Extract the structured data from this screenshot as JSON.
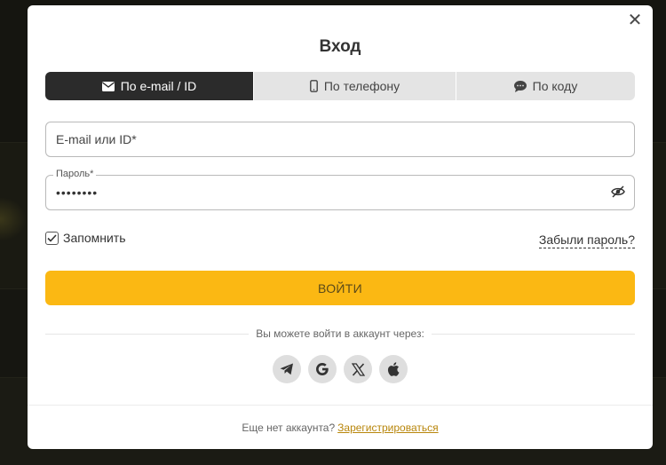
{
  "modal": {
    "title": "Вход",
    "close_icon": "close-icon"
  },
  "tabs": [
    {
      "label": "По e-mail / ID",
      "icon": "envelope-icon",
      "active": true
    },
    {
      "label": "По телефону",
      "icon": "mobile-phone-icon",
      "active": false
    },
    {
      "label": "По коду",
      "icon": "chat-bubble-icon",
      "active": false
    }
  ],
  "form": {
    "email_placeholder": "E-mail или ID*",
    "email_value": "",
    "password_label": "Пароль*",
    "password_value": "••••••••",
    "password_toggle_icon": "eye-slash-icon",
    "remember_label": "Запомнить",
    "remember_checked": true,
    "forgot_label": "Забыли пароль?",
    "submit_label": "ВОЙТИ"
  },
  "social": {
    "caption": "Вы можете войти в аккаунт через:",
    "providers": [
      "telegram-icon",
      "google-icon",
      "x-icon",
      "apple-icon"
    ]
  },
  "footer": {
    "text": "Еще нет аккаунта?",
    "register_label": "Зарегистрироваться"
  },
  "colors": {
    "accent": "#fbb813",
    "tab_active_bg": "#2b2b2b",
    "tab_bg": "#e4e4e4",
    "link": "#b8860b"
  }
}
